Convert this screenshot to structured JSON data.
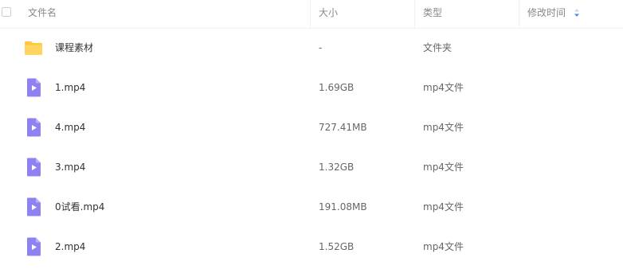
{
  "header": {
    "col_name": "文件名",
    "col_size": "大小",
    "col_type": "类型",
    "col_time": "修改时间",
    "sort_icon": "sort-desc-icon"
  },
  "colors": {
    "folder": "#FFC83D",
    "video": "#8E82F2",
    "accent": "#3B8CF5"
  },
  "files": [
    {
      "name": "课程素材",
      "size": "-",
      "type": "文件夹",
      "icon": "folder-icon"
    },
    {
      "name": "1.mp4",
      "size": "1.69GB",
      "type": "mp4文件",
      "icon": "video-file-icon"
    },
    {
      "name": "4.mp4",
      "size": "727.41MB",
      "type": "mp4文件",
      "icon": "video-file-icon"
    },
    {
      "name": "3.mp4",
      "size": "1.32GB",
      "type": "mp4文件",
      "icon": "video-file-icon"
    },
    {
      "name": "0试看.mp4",
      "size": "191.08MB",
      "type": "mp4文件",
      "icon": "video-file-icon"
    },
    {
      "name": "2.mp4",
      "size": "1.52GB",
      "type": "mp4文件",
      "icon": "video-file-icon"
    }
  ]
}
